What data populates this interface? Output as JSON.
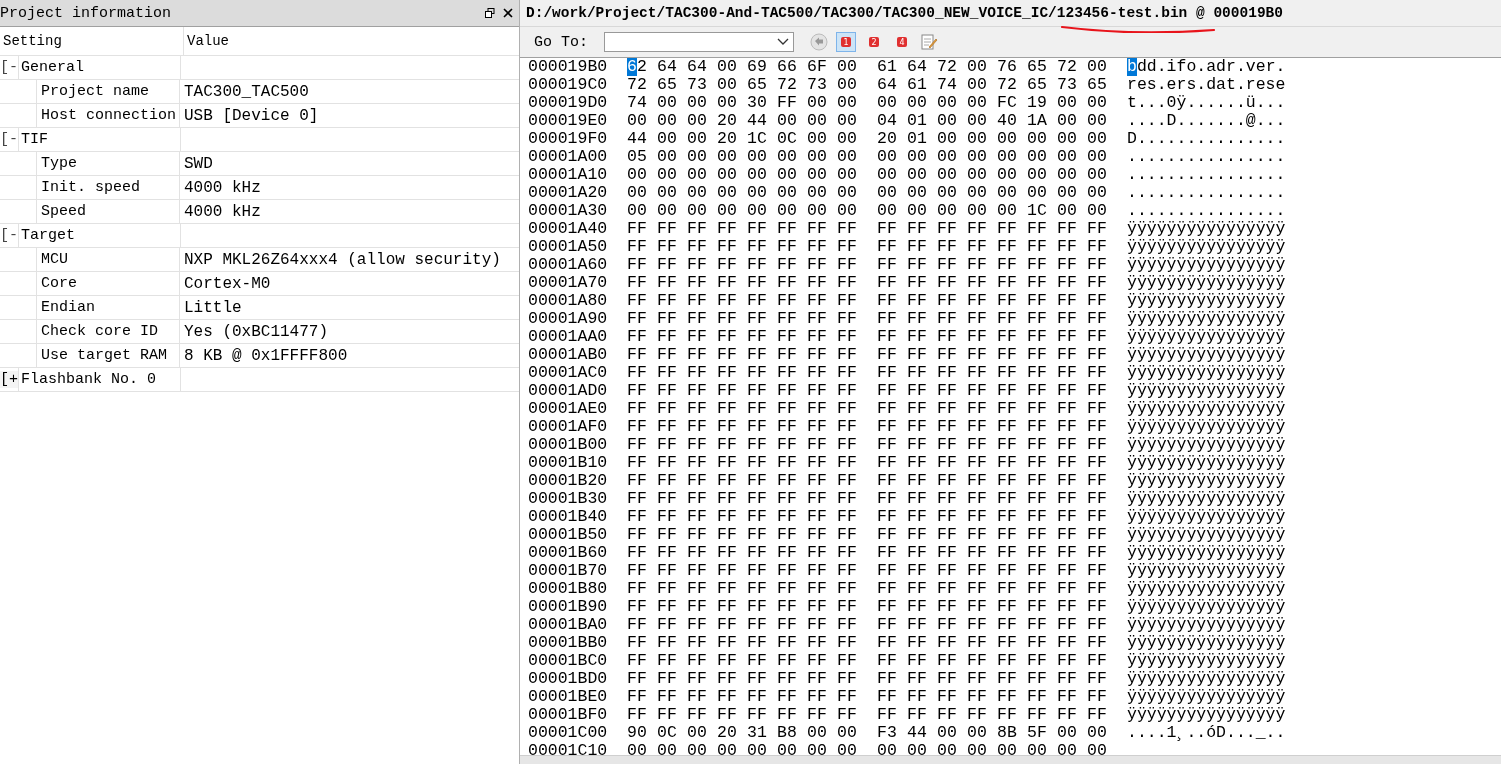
{
  "project_panel": {
    "title": "Project information",
    "columns": [
      "Setting",
      "Value"
    ],
    "groups": [
      {
        "label": "General",
        "expander": "[-",
        "expanded": true,
        "children": [
          {
            "setting": "Project name",
            "value": "TAC300_TAC500"
          },
          {
            "setting": "Host connection",
            "value": "USB [Device 0]"
          }
        ]
      },
      {
        "label": "TIF",
        "expander": "[-",
        "expanded": true,
        "children": [
          {
            "setting": "Type",
            "value": "SWD"
          },
          {
            "setting": "Init. speed",
            "value": "4000 kHz"
          },
          {
            "setting": "Speed",
            "value": "4000 kHz"
          }
        ]
      },
      {
        "label": "Target",
        "expander": "[-",
        "expanded": true,
        "children": [
          {
            "setting": "MCU",
            "value": "NXP MKL26Z64xxx4 (allow security)"
          },
          {
            "setting": "Core",
            "value": "Cortex-M0"
          },
          {
            "setting": "Endian",
            "value": "Little"
          },
          {
            "setting": "Check core ID",
            "value": "Yes (0xBC11477)"
          },
          {
            "setting": "Use target RAM",
            "value": "8 KB @ 0x1FFFF800"
          }
        ]
      },
      {
        "label": "Flashbank No. 0",
        "expander": "[+",
        "expanded": false
      }
    ]
  },
  "hex_view": {
    "title": "D:/work/Project/TAC300-And-TAC500/TAC300/TAC300_NEW_VOICE_IC/123456-test.bin @ 000019B0",
    "goto_label": "Go To:",
    "bookmarks": [
      {
        "label": "1",
        "selected": true
      },
      {
        "label": "2",
        "selected": false
      },
      {
        "label": "4",
        "selected": false
      }
    ],
    "rows": [
      {
        "address": "000019B0",
        "selected": true,
        "bytes": [
          "62",
          "64",
          "64",
          "00",
          "69",
          "66",
          "6F",
          "00",
          "61",
          "64",
          "72",
          "00",
          "76",
          "65",
          "72",
          "00"
        ],
        "ascii": "bdd.ifo.adr.ver."
      },
      {
        "address": "000019C0",
        "selected": false,
        "bytes": [
          "72",
          "65",
          "73",
          "00",
          "65",
          "72",
          "73",
          "00",
          "64",
          "61",
          "74",
          "00",
          "72",
          "65",
          "73",
          "65"
        ],
        "ascii": "res.ers.dat.rese"
      },
      {
        "address": "000019D0",
        "selected": false,
        "bytes": [
          "74",
          "00",
          "00",
          "00",
          "30",
          "FF",
          "00",
          "00",
          "00",
          "00",
          "00",
          "00",
          "FC",
          "19",
          "00",
          "00"
        ],
        "ascii": "t...0ÿ......ü..."
      },
      {
        "address": "000019E0",
        "selected": false,
        "bytes": [
          "00",
          "00",
          "00",
          "20",
          "44",
          "00",
          "00",
          "00",
          "04",
          "01",
          "00",
          "00",
          "40",
          "1A",
          "00",
          "00"
        ],
        "ascii": "....D.......@..."
      },
      {
        "address": "000019F0",
        "selected": false,
        "bytes": [
          "44",
          "00",
          "00",
          "20",
          "1C",
          "0C",
          "00",
          "00",
          "20",
          "01",
          "00",
          "00",
          "00",
          "00",
          "00",
          "00"
        ],
        "ascii": "D..............."
      },
      {
        "address": "00001A00",
        "selected": false,
        "bytes": [
          "05",
          "00",
          "00",
          "00",
          "00",
          "00",
          "00",
          "00",
          "00",
          "00",
          "00",
          "00",
          "00",
          "00",
          "00",
          "00"
        ],
        "ascii": "................"
      },
      {
        "address": "00001A10",
        "selected": false,
        "bytes": [
          "00",
          "00",
          "00",
          "00",
          "00",
          "00",
          "00",
          "00",
          "00",
          "00",
          "00",
          "00",
          "00",
          "00",
          "00",
          "00"
        ],
        "ascii": "................"
      },
      {
        "address": "00001A20",
        "selected": false,
        "bytes": [
          "00",
          "00",
          "00",
          "00",
          "00",
          "00",
          "00",
          "00",
          "00",
          "00",
          "00",
          "00",
          "00",
          "00",
          "00",
          "00"
        ],
        "ascii": "................"
      },
      {
        "address": "00001A30",
        "selected": false,
        "bytes": [
          "00",
          "00",
          "00",
          "00",
          "00",
          "00",
          "00",
          "00",
          "00",
          "00",
          "00",
          "00",
          "00",
          "1C",
          "00",
          "00"
        ],
        "ascii": "................"
      },
      {
        "address": "00001A40",
        "selected": false,
        "bytes": [
          "FF",
          "FF",
          "FF",
          "FF",
          "FF",
          "FF",
          "FF",
          "FF",
          "FF",
          "FF",
          "FF",
          "FF",
          "FF",
          "FF",
          "FF",
          "FF"
        ],
        "ascii": "ÿÿÿÿÿÿÿÿÿÿÿÿÿÿÿÿ"
      },
      {
        "address": "00001A50",
        "selected": false,
        "bytes": [
          "FF",
          "FF",
          "FF",
          "FF",
          "FF",
          "FF",
          "FF",
          "FF",
          "FF",
          "FF",
          "FF",
          "FF",
          "FF",
          "FF",
          "FF",
          "FF"
        ],
        "ascii": "ÿÿÿÿÿÿÿÿÿÿÿÿÿÿÿÿ"
      },
      {
        "address": "00001A60",
        "selected": false,
        "bytes": [
          "FF",
          "FF",
          "FF",
          "FF",
          "FF",
          "FF",
          "FF",
          "FF",
          "FF",
          "FF",
          "FF",
          "FF",
          "FF",
          "FF",
          "FF",
          "FF"
        ],
        "ascii": "ÿÿÿÿÿÿÿÿÿÿÿÿÿÿÿÿ"
      },
      {
        "address": "00001A70",
        "selected": false,
        "bytes": [
          "FF",
          "FF",
          "FF",
          "FF",
          "FF",
          "FF",
          "FF",
          "FF",
          "FF",
          "FF",
          "FF",
          "FF",
          "FF",
          "FF",
          "FF",
          "FF"
        ],
        "ascii": "ÿÿÿÿÿÿÿÿÿÿÿÿÿÿÿÿ"
      },
      {
        "address": "00001A80",
        "selected": false,
        "bytes": [
          "FF",
          "FF",
          "FF",
          "FF",
          "FF",
          "FF",
          "FF",
          "FF",
          "FF",
          "FF",
          "FF",
          "FF",
          "FF",
          "FF",
          "FF",
          "FF"
        ],
        "ascii": "ÿÿÿÿÿÿÿÿÿÿÿÿÿÿÿÿ"
      },
      {
        "address": "00001A90",
        "selected": false,
        "bytes": [
          "FF",
          "FF",
          "FF",
          "FF",
          "FF",
          "FF",
          "FF",
          "FF",
          "FF",
          "FF",
          "FF",
          "FF",
          "FF",
          "FF",
          "FF",
          "FF"
        ],
        "ascii": "ÿÿÿÿÿÿÿÿÿÿÿÿÿÿÿÿ"
      },
      {
        "address": "00001AA0",
        "selected": false,
        "bytes": [
          "FF",
          "FF",
          "FF",
          "FF",
          "FF",
          "FF",
          "FF",
          "FF",
          "FF",
          "FF",
          "FF",
          "FF",
          "FF",
          "FF",
          "FF",
          "FF"
        ],
        "ascii": "ÿÿÿÿÿÿÿÿÿÿÿÿÿÿÿÿ"
      },
      {
        "address": "00001AB0",
        "selected": false,
        "bytes": [
          "FF",
          "FF",
          "FF",
          "FF",
          "FF",
          "FF",
          "FF",
          "FF",
          "FF",
          "FF",
          "FF",
          "FF",
          "FF",
          "FF",
          "FF",
          "FF"
        ],
        "ascii": "ÿÿÿÿÿÿÿÿÿÿÿÿÿÿÿÿ"
      },
      {
        "address": "00001AC0",
        "selected": false,
        "bytes": [
          "FF",
          "FF",
          "FF",
          "FF",
          "FF",
          "FF",
          "FF",
          "FF",
          "FF",
          "FF",
          "FF",
          "FF",
          "FF",
          "FF",
          "FF",
          "FF"
        ],
        "ascii": "ÿÿÿÿÿÿÿÿÿÿÿÿÿÿÿÿ"
      },
      {
        "address": "00001AD0",
        "selected": false,
        "bytes": [
          "FF",
          "FF",
          "FF",
          "FF",
          "FF",
          "FF",
          "FF",
          "FF",
          "FF",
          "FF",
          "FF",
          "FF",
          "FF",
          "FF",
          "FF",
          "FF"
        ],
        "ascii": "ÿÿÿÿÿÿÿÿÿÿÿÿÿÿÿÿ"
      },
      {
        "address": "00001AE0",
        "selected": false,
        "bytes": [
          "FF",
          "FF",
          "FF",
          "FF",
          "FF",
          "FF",
          "FF",
          "FF",
          "FF",
          "FF",
          "FF",
          "FF",
          "FF",
          "FF",
          "FF",
          "FF"
        ],
        "ascii": "ÿÿÿÿÿÿÿÿÿÿÿÿÿÿÿÿ"
      },
      {
        "address": "00001AF0",
        "selected": false,
        "bytes": [
          "FF",
          "FF",
          "FF",
          "FF",
          "FF",
          "FF",
          "FF",
          "FF",
          "FF",
          "FF",
          "FF",
          "FF",
          "FF",
          "FF",
          "FF",
          "FF"
        ],
        "ascii": "ÿÿÿÿÿÿÿÿÿÿÿÿÿÿÿÿ"
      },
      {
        "address": "00001B00",
        "selected": false,
        "bytes": [
          "FF",
          "FF",
          "FF",
          "FF",
          "FF",
          "FF",
          "FF",
          "FF",
          "FF",
          "FF",
          "FF",
          "FF",
          "FF",
          "FF",
          "FF",
          "FF"
        ],
        "ascii": "ÿÿÿÿÿÿÿÿÿÿÿÿÿÿÿÿ"
      },
      {
        "address": "00001B10",
        "selected": false,
        "bytes": [
          "FF",
          "FF",
          "FF",
          "FF",
          "FF",
          "FF",
          "FF",
          "FF",
          "FF",
          "FF",
          "FF",
          "FF",
          "FF",
          "FF",
          "FF",
          "FF"
        ],
        "ascii": "ÿÿÿÿÿÿÿÿÿÿÿÿÿÿÿÿ"
      },
      {
        "address": "00001B20",
        "selected": false,
        "bytes": [
          "FF",
          "FF",
          "FF",
          "FF",
          "FF",
          "FF",
          "FF",
          "FF",
          "FF",
          "FF",
          "FF",
          "FF",
          "FF",
          "FF",
          "FF",
          "FF"
        ],
        "ascii": "ÿÿÿÿÿÿÿÿÿÿÿÿÿÿÿÿ"
      },
      {
        "address": "00001B30",
        "selected": false,
        "bytes": [
          "FF",
          "FF",
          "FF",
          "FF",
          "FF",
          "FF",
          "FF",
          "FF",
          "FF",
          "FF",
          "FF",
          "FF",
          "FF",
          "FF",
          "FF",
          "FF"
        ],
        "ascii": "ÿÿÿÿÿÿÿÿÿÿÿÿÿÿÿÿ"
      },
      {
        "address": "00001B40",
        "selected": false,
        "bytes": [
          "FF",
          "FF",
          "FF",
          "FF",
          "FF",
          "FF",
          "FF",
          "FF",
          "FF",
          "FF",
          "FF",
          "FF",
          "FF",
          "FF",
          "FF",
          "FF"
        ],
        "ascii": "ÿÿÿÿÿÿÿÿÿÿÿÿÿÿÿÿ"
      },
      {
        "address": "00001B50",
        "selected": false,
        "bytes": [
          "FF",
          "FF",
          "FF",
          "FF",
          "FF",
          "FF",
          "FF",
          "FF",
          "FF",
          "FF",
          "FF",
          "FF",
          "FF",
          "FF",
          "FF",
          "FF"
        ],
        "ascii": "ÿÿÿÿÿÿÿÿÿÿÿÿÿÿÿÿ"
      },
      {
        "address": "00001B60",
        "selected": false,
        "bytes": [
          "FF",
          "FF",
          "FF",
          "FF",
          "FF",
          "FF",
          "FF",
          "FF",
          "FF",
          "FF",
          "FF",
          "FF",
          "FF",
          "FF",
          "FF",
          "FF"
        ],
        "ascii": "ÿÿÿÿÿÿÿÿÿÿÿÿÿÿÿÿ"
      },
      {
        "address": "00001B70",
        "selected": false,
        "bytes": [
          "FF",
          "FF",
          "FF",
          "FF",
          "FF",
          "FF",
          "FF",
          "FF",
          "FF",
          "FF",
          "FF",
          "FF",
          "FF",
          "FF",
          "FF",
          "FF"
        ],
        "ascii": "ÿÿÿÿÿÿÿÿÿÿÿÿÿÿÿÿ"
      },
      {
        "address": "00001B80",
        "selected": false,
        "bytes": [
          "FF",
          "FF",
          "FF",
          "FF",
          "FF",
          "FF",
          "FF",
          "FF",
          "FF",
          "FF",
          "FF",
          "FF",
          "FF",
          "FF",
          "FF",
          "FF"
        ],
        "ascii": "ÿÿÿÿÿÿÿÿÿÿÿÿÿÿÿÿ"
      },
      {
        "address": "00001B90",
        "selected": false,
        "bytes": [
          "FF",
          "FF",
          "FF",
          "FF",
          "FF",
          "FF",
          "FF",
          "FF",
          "FF",
          "FF",
          "FF",
          "FF",
          "FF",
          "FF",
          "FF",
          "FF"
        ],
        "ascii": "ÿÿÿÿÿÿÿÿÿÿÿÿÿÿÿÿ"
      },
      {
        "address": "00001BA0",
        "selected": false,
        "bytes": [
          "FF",
          "FF",
          "FF",
          "FF",
          "FF",
          "FF",
          "FF",
          "FF",
          "FF",
          "FF",
          "FF",
          "FF",
          "FF",
          "FF",
          "FF",
          "FF"
        ],
        "ascii": "ÿÿÿÿÿÿÿÿÿÿÿÿÿÿÿÿ"
      },
      {
        "address": "00001BB0",
        "selected": false,
        "bytes": [
          "FF",
          "FF",
          "FF",
          "FF",
          "FF",
          "FF",
          "FF",
          "FF",
          "FF",
          "FF",
          "FF",
          "FF",
          "FF",
          "FF",
          "FF",
          "FF"
        ],
        "ascii": "ÿÿÿÿÿÿÿÿÿÿÿÿÿÿÿÿ"
      },
      {
        "address": "00001BC0",
        "selected": false,
        "bytes": [
          "FF",
          "FF",
          "FF",
          "FF",
          "FF",
          "FF",
          "FF",
          "FF",
          "FF",
          "FF",
          "FF",
          "FF",
          "FF",
          "FF",
          "FF",
          "FF"
        ],
        "ascii": "ÿÿÿÿÿÿÿÿÿÿÿÿÿÿÿÿ"
      },
      {
        "address": "00001BD0",
        "selected": false,
        "bytes": [
          "FF",
          "FF",
          "FF",
          "FF",
          "FF",
          "FF",
          "FF",
          "FF",
          "FF",
          "FF",
          "FF",
          "FF",
          "FF",
          "FF",
          "FF",
          "FF"
        ],
        "ascii": "ÿÿÿÿÿÿÿÿÿÿÿÿÿÿÿÿ"
      },
      {
        "address": "00001BE0",
        "selected": false,
        "bytes": [
          "FF",
          "FF",
          "FF",
          "FF",
          "FF",
          "FF",
          "FF",
          "FF",
          "FF",
          "FF",
          "FF",
          "FF",
          "FF",
          "FF",
          "FF",
          "FF"
        ],
        "ascii": "ÿÿÿÿÿÿÿÿÿÿÿÿÿÿÿÿ"
      },
      {
        "address": "00001BF0",
        "selected": false,
        "bytes": [
          "FF",
          "FF",
          "FF",
          "FF",
          "FF",
          "FF",
          "FF",
          "FF",
          "FF",
          "FF",
          "FF",
          "FF",
          "FF",
          "FF",
          "FF",
          "FF"
        ],
        "ascii": "ÿÿÿÿÿÿÿÿÿÿÿÿÿÿÿÿ"
      },
      {
        "address": "00001C00",
        "selected": false,
        "bytes": [
          "90",
          "0C",
          "00",
          "20",
          "31",
          "B8",
          "00",
          "00",
          "F3",
          "44",
          "00",
          "00",
          "8B",
          "5F",
          "00",
          "00"
        ],
        "ascii": "....1¸..óD..._.."
      },
      {
        "address": "00001C10",
        "selected": false,
        "bytes": [
          "00",
          "00",
          "00",
          "00",
          "00",
          "00",
          "00",
          "00",
          "00",
          "00",
          "00",
          "00",
          "00",
          "00",
          "00",
          "00"
        ]
      }
    ]
  }
}
